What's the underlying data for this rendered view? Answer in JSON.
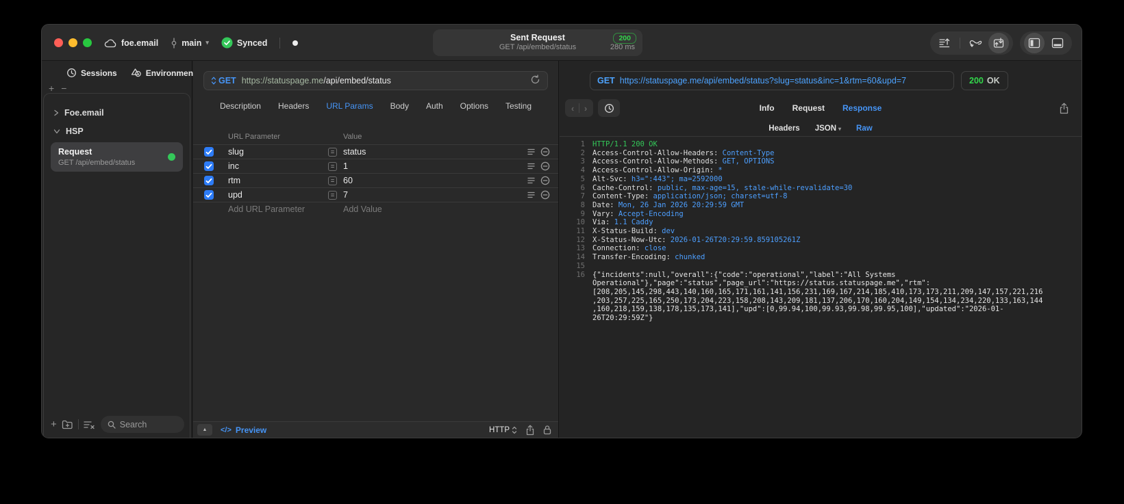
{
  "titlebar": {
    "project": "foe.email",
    "branch": "main",
    "sync_status": "Synced",
    "request": {
      "title": "Sent Request",
      "subtitle": "GET /api/embed/status",
      "status_code": "200",
      "duration": "280 ms"
    }
  },
  "sidebar": {
    "tabs": [
      {
        "label": "Sessions"
      },
      {
        "label": "Environments"
      }
    ],
    "tree": [
      {
        "label": "Foe.email"
      },
      {
        "label": "HSP"
      }
    ],
    "selected_request": {
      "title": "Request",
      "subtitle": "GET /api/embed/status"
    },
    "search_placeholder": "Search"
  },
  "request_panel": {
    "method": "GET",
    "url_host": "https://statuspage.me",
    "url_path": "/api/embed/status",
    "tabs": [
      {
        "label": "Description"
      },
      {
        "label": "Headers"
      },
      {
        "label": "URL Params"
      },
      {
        "label": "Body"
      },
      {
        "label": "Auth"
      },
      {
        "label": "Options"
      },
      {
        "label": "Testing"
      }
    ],
    "active_tab": "URL Params",
    "params": {
      "columns": {
        "name": "URL Parameter",
        "value": "Value"
      },
      "rows": [
        {
          "name": "slug",
          "value": "status",
          "enabled": true
        },
        {
          "name": "inc",
          "value": "1",
          "enabled": true
        },
        {
          "name": "rtm",
          "value": "60",
          "enabled": true
        },
        {
          "name": "upd",
          "value": "7",
          "enabled": true
        }
      ],
      "add_row": {
        "name": "Add URL Parameter",
        "value": "Add Value"
      }
    },
    "footer": {
      "preview": "Preview",
      "code_glyph": "</>",
      "protocol": "HTTP"
    }
  },
  "response_panel": {
    "method": "GET",
    "url": "https://statuspage.me/api/embed/status?slug=status&inc=1&rtm=60&upd=7",
    "status_code": "200",
    "status_text": "OK",
    "tabs": [
      {
        "label": "Info"
      },
      {
        "label": "Request"
      },
      {
        "label": "Response"
      }
    ],
    "active_tab": "Response",
    "subtabs": [
      {
        "label": "Headers"
      },
      {
        "label": "JSON"
      },
      {
        "label": "Raw"
      }
    ],
    "active_subtab": "Raw",
    "body": {
      "status_line": {
        "num": "1",
        "text": "HTTP/1.1 200 OK"
      },
      "headers": [
        {
          "num": "2",
          "name": "Access-Control-Allow-Headers:",
          "value": " Content-Type"
        },
        {
          "num": "3",
          "name": "Access-Control-Allow-Methods:",
          "value": " GET, OPTIONS"
        },
        {
          "num": "4",
          "name": "Access-Control-Allow-Origin:",
          "value": " *"
        },
        {
          "num": "5",
          "name": "Alt-Svc:",
          "value": " h3=\":443\"; ma=2592000"
        },
        {
          "num": "6",
          "name": "Cache-Control:",
          "value": " public, max-age=15, stale-while-revalidate=30"
        },
        {
          "num": "7",
          "name": "Content-Type:",
          "value": " application/json; charset=utf-8"
        },
        {
          "num": "8",
          "name": "Date:",
          "value": " Mon, 26 Jan 2026 20:29:59 GMT"
        },
        {
          "num": "9",
          "name": "Vary:",
          "value": " Accept-Encoding"
        },
        {
          "num": "10",
          "name": "Via:",
          "value": " 1.1 Caddy"
        },
        {
          "num": "11",
          "name": "X-Status-Build:",
          "value": " dev"
        },
        {
          "num": "12",
          "name": "X-Status-Now-Utc:",
          "value": " 2026-01-26T20:29:59.859105261Z"
        },
        {
          "num": "13",
          "name": "Connection:",
          "value": " close"
        },
        {
          "num": "14",
          "name": "Transfer-Encoding:",
          "value": " chunked"
        }
      ],
      "blank": {
        "num": "15"
      },
      "json": {
        "num": "16",
        "text": "{\"incidents\":null,\"overall\":{\"code\":\"operational\",\"label\":\"All Systems Operational\"},\"page\":\"status\",\"page_url\":\"https://status.statuspage.me\",\"rtm\":[208,205,145,298,443,140,160,165,171,161,141,156,231,169,167,214,185,410,173,173,211,209,147,157,221,216,203,257,225,165,250,173,204,223,158,208,143,209,181,137,206,170,160,204,149,154,134,234,220,133,163,144,160,218,159,138,178,135,173,141],\"upd\":[0,99.94,100,99.93,99.98,99.95,100],\"updated\":\"2026-01-26T20:29:59Z\"}"
      }
    }
  },
  "colors": {
    "accent_blue": "#4695f7",
    "link_blue": "#4da3ff",
    "green": "#32d74b",
    "host_green": "#a6b8a2"
  }
}
